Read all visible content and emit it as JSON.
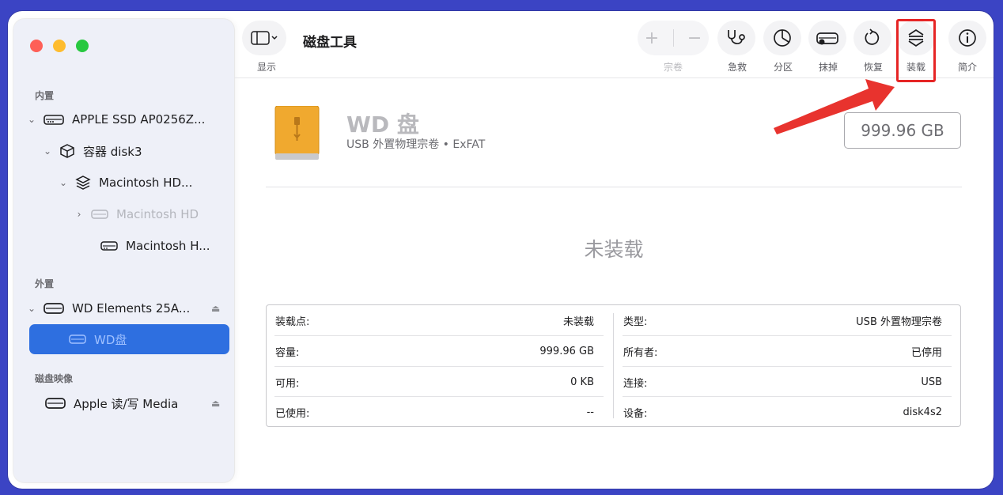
{
  "toolbar": {
    "title": "磁盘工具",
    "view_label": "显示",
    "volume_label": "宗卷",
    "first_aid_label": "急救",
    "partition_label": "分区",
    "erase_label": "抹掉",
    "restore_label": "恢复",
    "mount_label": "装载",
    "info_label": "简介"
  },
  "sidebar": {
    "internal_header": "内置",
    "external_header": "外置",
    "images_header": "磁盘映像",
    "items": [
      {
        "label": "APPLE SSD AP0256Z..."
      },
      {
        "label": "容器 disk3"
      },
      {
        "label": "Macintosh HD..."
      },
      {
        "label": "Macintosh HD"
      },
      {
        "label": "Macintosh H..."
      },
      {
        "label": "WD Elements 25A..."
      },
      {
        "label": "WD盘"
      },
      {
        "label": "Apple 读/写 Media"
      }
    ]
  },
  "main": {
    "disk_name": "WD 盘",
    "disk_subtitle": "USB 外置物理宗卷 • ExFAT",
    "capacity": "999.96 GB",
    "status": "未装载",
    "info_left": [
      {
        "key": "装载点:",
        "value": "未装载"
      },
      {
        "key": "容量:",
        "value": "999.96 GB"
      },
      {
        "key": "可用:",
        "value": "0 KB"
      },
      {
        "key": "已使用:",
        "value": "--"
      }
    ],
    "info_right": [
      {
        "key": "类型:",
        "value": "USB 外置物理宗卷"
      },
      {
        "key": "所有者:",
        "value": "已停用"
      },
      {
        "key": "连接:",
        "value": "USB"
      },
      {
        "key": "设备:",
        "value": "disk4s2"
      }
    ]
  },
  "colors": {
    "accent": "#2e6fe0",
    "highlight": "#e62525",
    "backdrop": "#3b44c4"
  }
}
